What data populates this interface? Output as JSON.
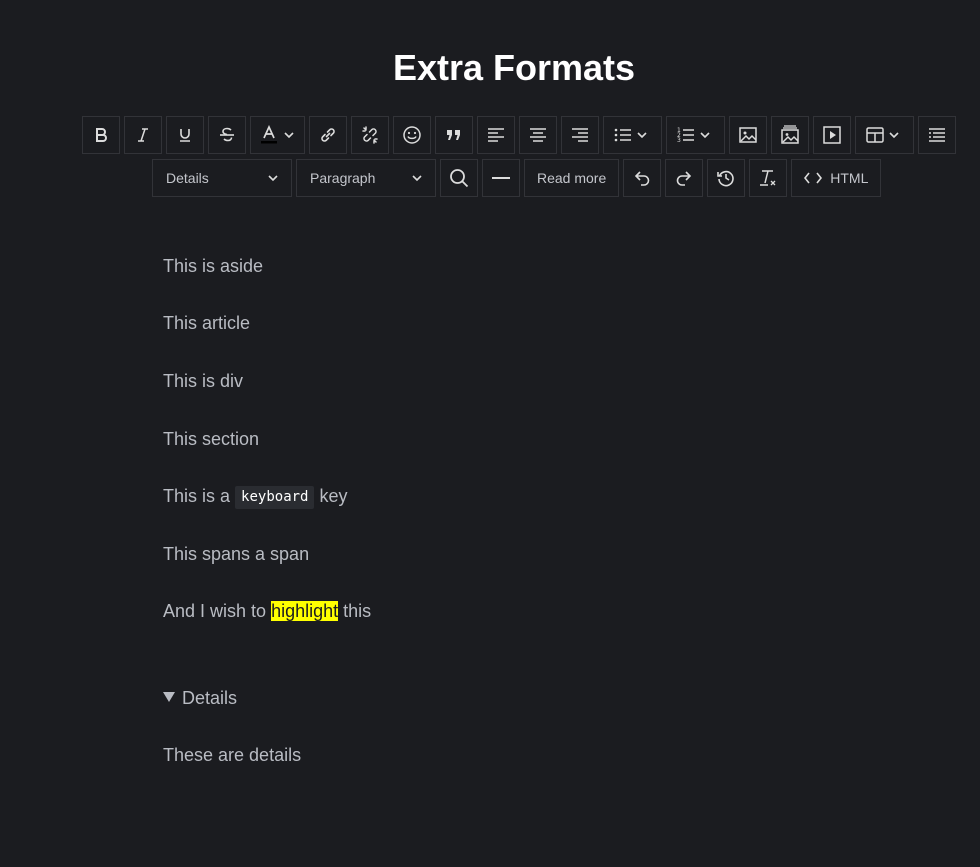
{
  "page": {
    "title": "Extra Formats"
  },
  "toolbar": {
    "row1": [
      {
        "name": "bold-button",
        "icon": "bold-icon"
      },
      {
        "name": "italic-button",
        "icon": "italic-icon"
      },
      {
        "name": "underline-button",
        "icon": "underline-icon"
      },
      {
        "name": "strikethrough-button",
        "icon": "strikethrough-icon"
      },
      {
        "name": "font-color-button",
        "icon": "font-color-icon"
      },
      {
        "name": "link-button",
        "icon": "link-icon"
      },
      {
        "name": "unlink-button",
        "icon": "unlink-icon"
      },
      {
        "name": "emoji-button",
        "icon": "emoji-icon"
      },
      {
        "name": "blockquote-button",
        "icon": "quote-icon"
      },
      {
        "name": "align-left-button",
        "icon": "align-left-icon"
      },
      {
        "name": "align-center-button",
        "icon": "align-center-icon"
      },
      {
        "name": "align-right-button",
        "icon": "align-right-icon"
      },
      {
        "name": "bullet-list-button",
        "icon": "bullet-list-icon"
      },
      {
        "name": "numbered-list-button",
        "icon": "numbered-list-icon"
      },
      {
        "name": "image-button",
        "icon": "image-icon"
      },
      {
        "name": "gallery-button",
        "icon": "gallery-icon"
      },
      {
        "name": "video-button",
        "icon": "video-icon"
      },
      {
        "name": "table-button",
        "icon": "table-icon"
      },
      {
        "name": "table-of-contents-button",
        "icon": "toc-icon"
      }
    ],
    "details_select": "Details",
    "paragraph_select": "Paragraph",
    "read_more_label": "Read more",
    "html_label": "HTML"
  },
  "content": {
    "aside": "This is aside",
    "article": "This article",
    "div": "This is div",
    "section": "This section",
    "keyboard_prefix": "This is a",
    "keyboard_text": "keyboard",
    "keyboard_suffix": "key",
    "span": "This spans a span",
    "highlight_prefix": "And I wish to",
    "highlight_text": "highlight",
    "highlight_suffix": "this",
    "details_summary": "Details",
    "details_body": "These are details"
  },
  "colors": {
    "background": "#1b1c20",
    "text": "#b9bcc3",
    "title": "#ffffff",
    "highlight": "#ffff00",
    "border": "#323338"
  }
}
